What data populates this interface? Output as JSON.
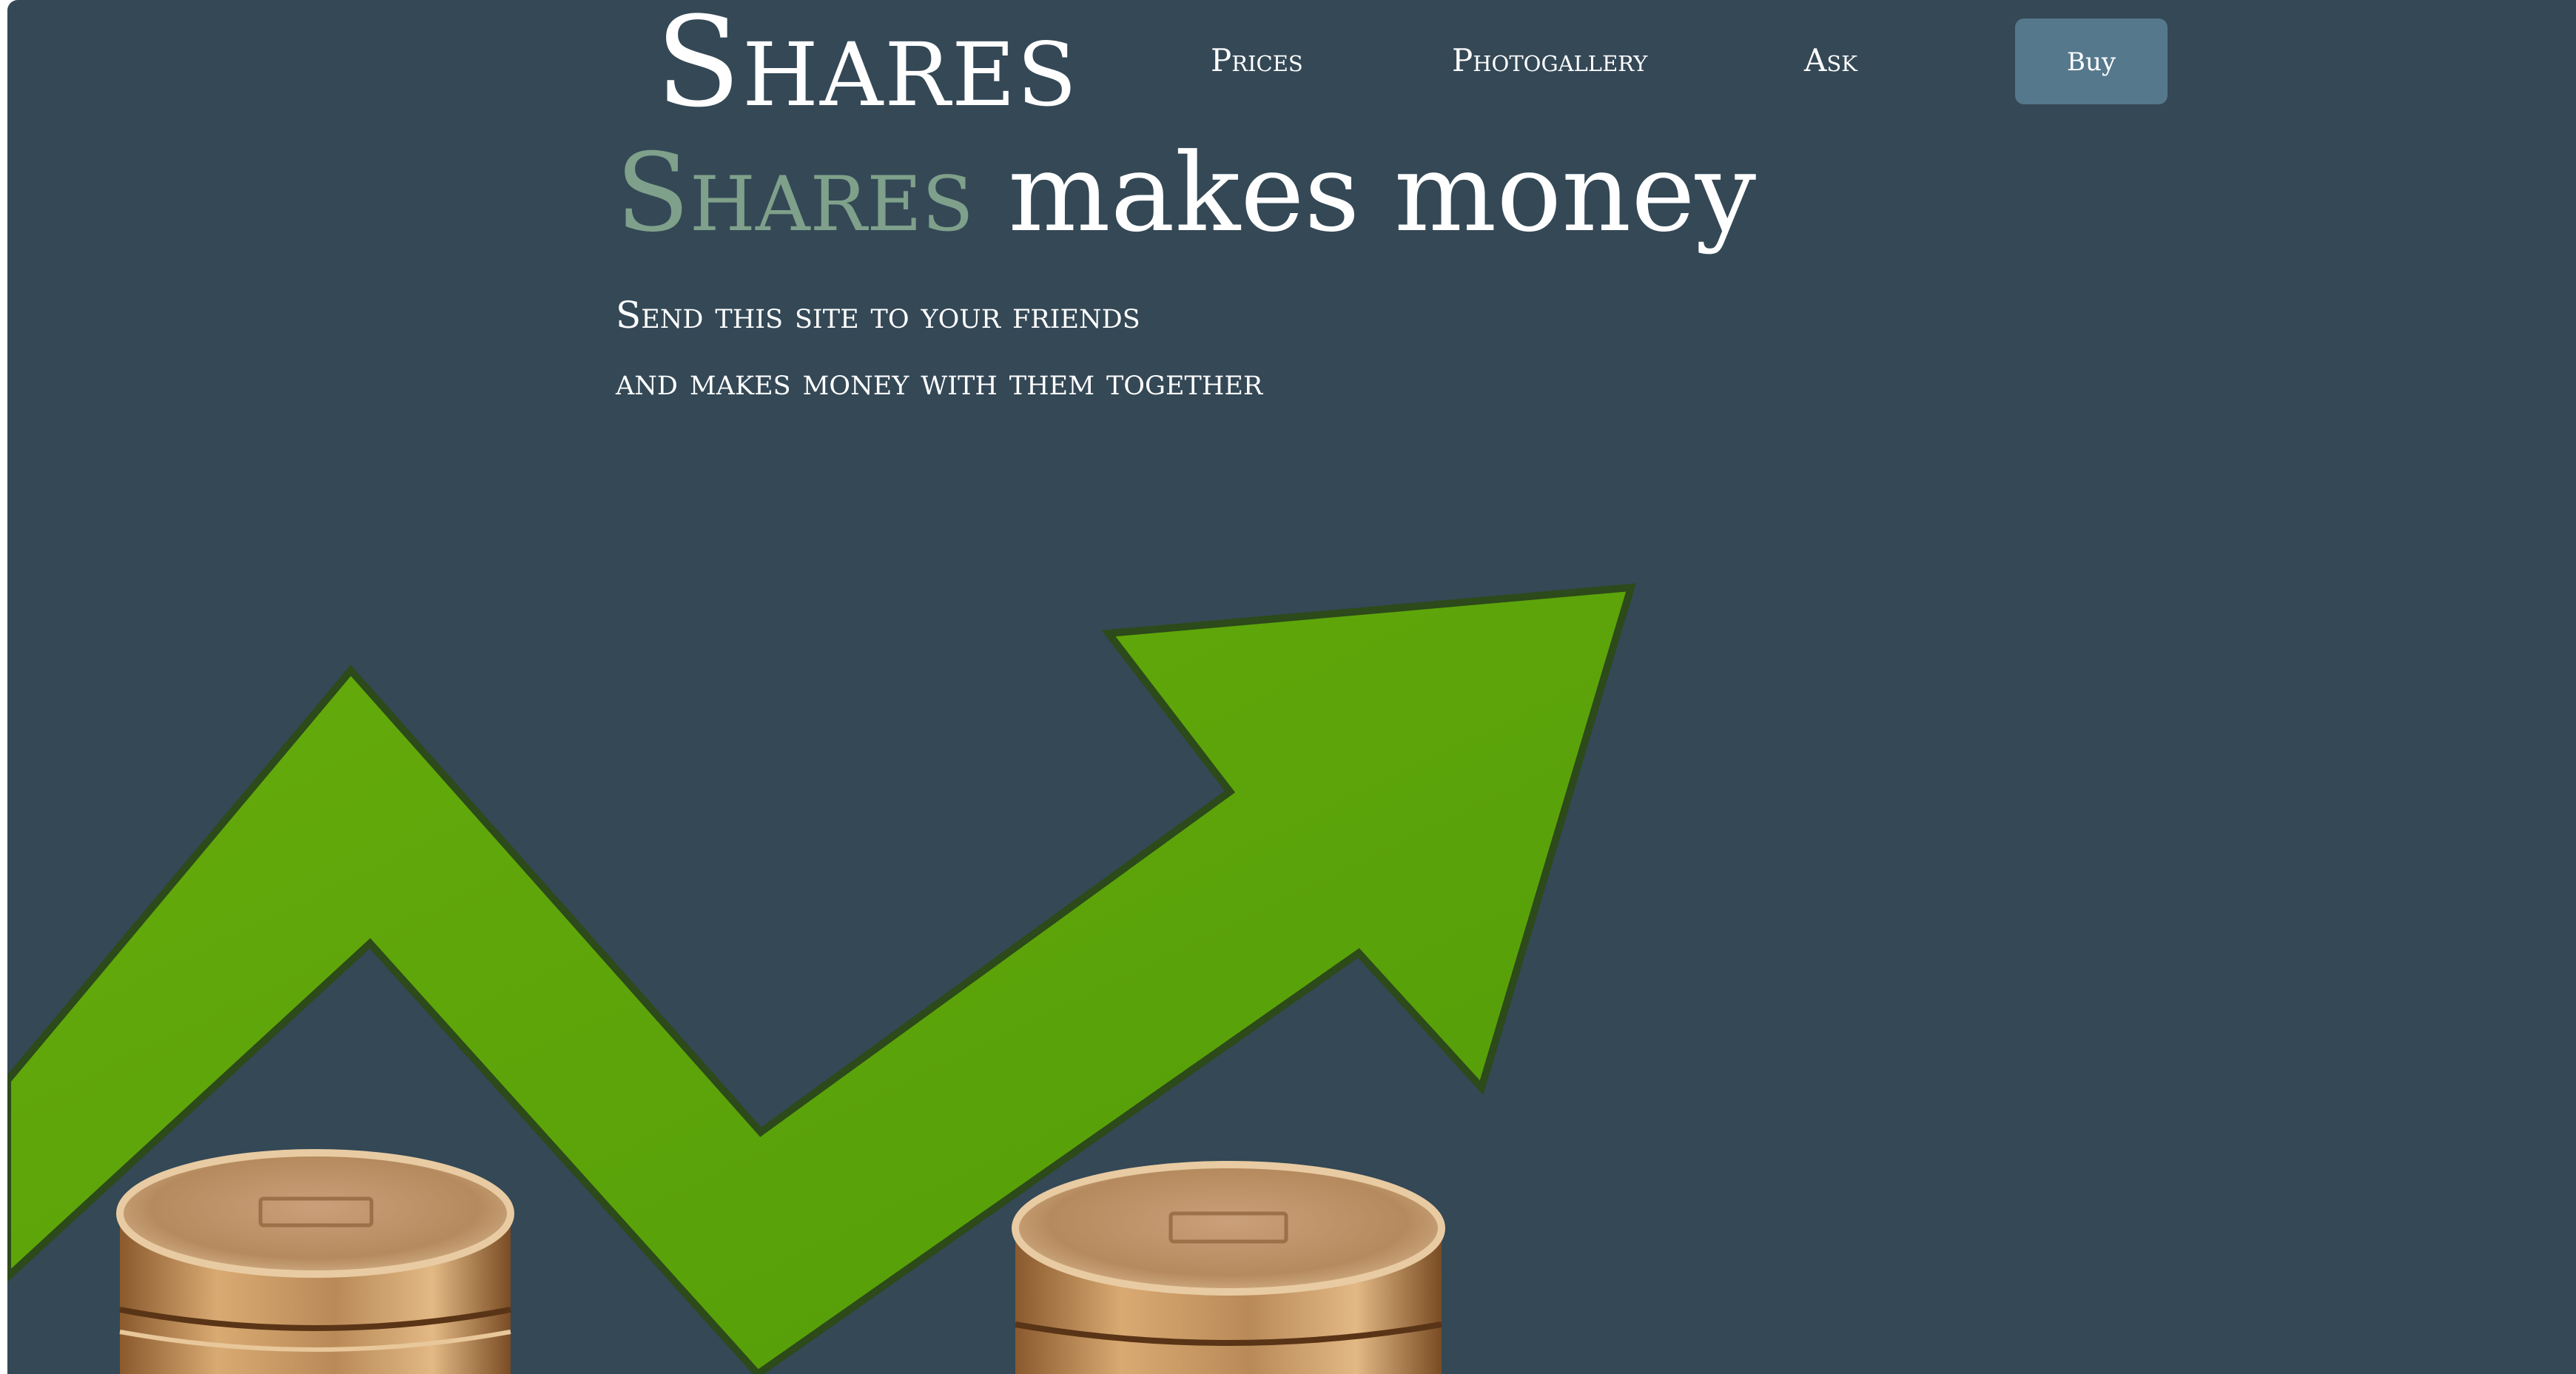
{
  "header": {
    "logo": "Shares",
    "nav": [
      "Prices",
      "Photogallery",
      "Ask"
    ],
    "buy_label": "Buy"
  },
  "hero": {
    "title_accent": "Shares",
    "title_rest": "makes money",
    "line1": "Send this site to your friends",
    "line2": "and makes money with them together"
  },
  "illustration": {
    "icon": "growth-arrow-with-coins"
  },
  "colors": {
    "background": "#344856",
    "accent": "#7fa08a",
    "button": "#56788c",
    "arrow": "#5ea60a",
    "coin": "#b98a58"
  }
}
